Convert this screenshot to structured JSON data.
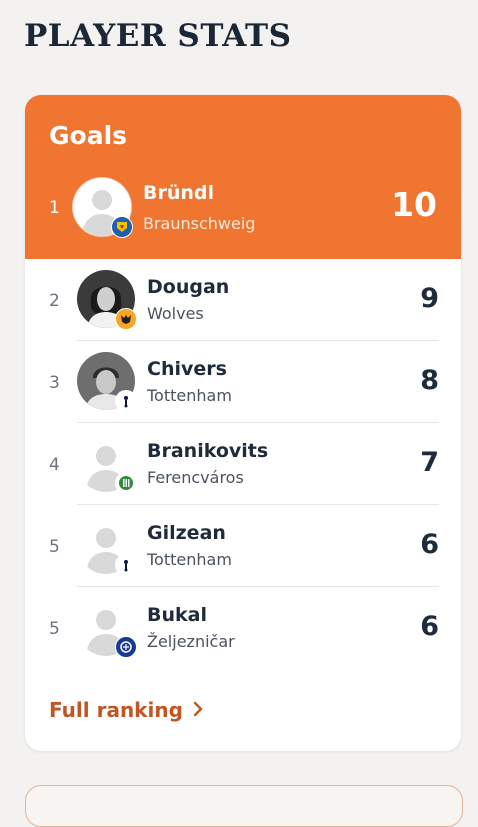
{
  "page": {
    "title": "PLAYER STATS"
  },
  "card": {
    "title": "Goals",
    "leader": {
      "rank": "1",
      "name": "Bründl",
      "club": "Braunschweig",
      "value": "10",
      "badge_color": "#1f5fb0",
      "badge_accent": "#f2c200"
    },
    "rows": [
      {
        "rank": "2",
        "name": "Dougan",
        "club": "Wolves",
        "value": "9",
        "badge_color": "#f5a623",
        "photo": "dark"
      },
      {
        "rank": "3",
        "name": "Chivers",
        "club": "Tottenham",
        "value": "8",
        "badge_color": "#0b1a3a",
        "photo": "grey"
      },
      {
        "rank": "4",
        "name": "Branikovits",
        "club": "Ferencváros",
        "value": "7",
        "badge_color": "#2e8b3c",
        "photo": "placeholder"
      },
      {
        "rank": "5",
        "name": "Gilzean",
        "club": "Tottenham",
        "value": "6",
        "badge_color": "#0b1a3a",
        "photo": "placeholder"
      },
      {
        "rank": "5",
        "name": "Bukal",
        "club": "Željezničar",
        "value": "6",
        "badge_color": "#1a3a8f",
        "photo": "placeholder"
      }
    ],
    "full_ranking_label": "Full ranking"
  },
  "colors": {
    "accent": "#f07530",
    "link": "#c05621",
    "text": "#1f2a3a"
  }
}
